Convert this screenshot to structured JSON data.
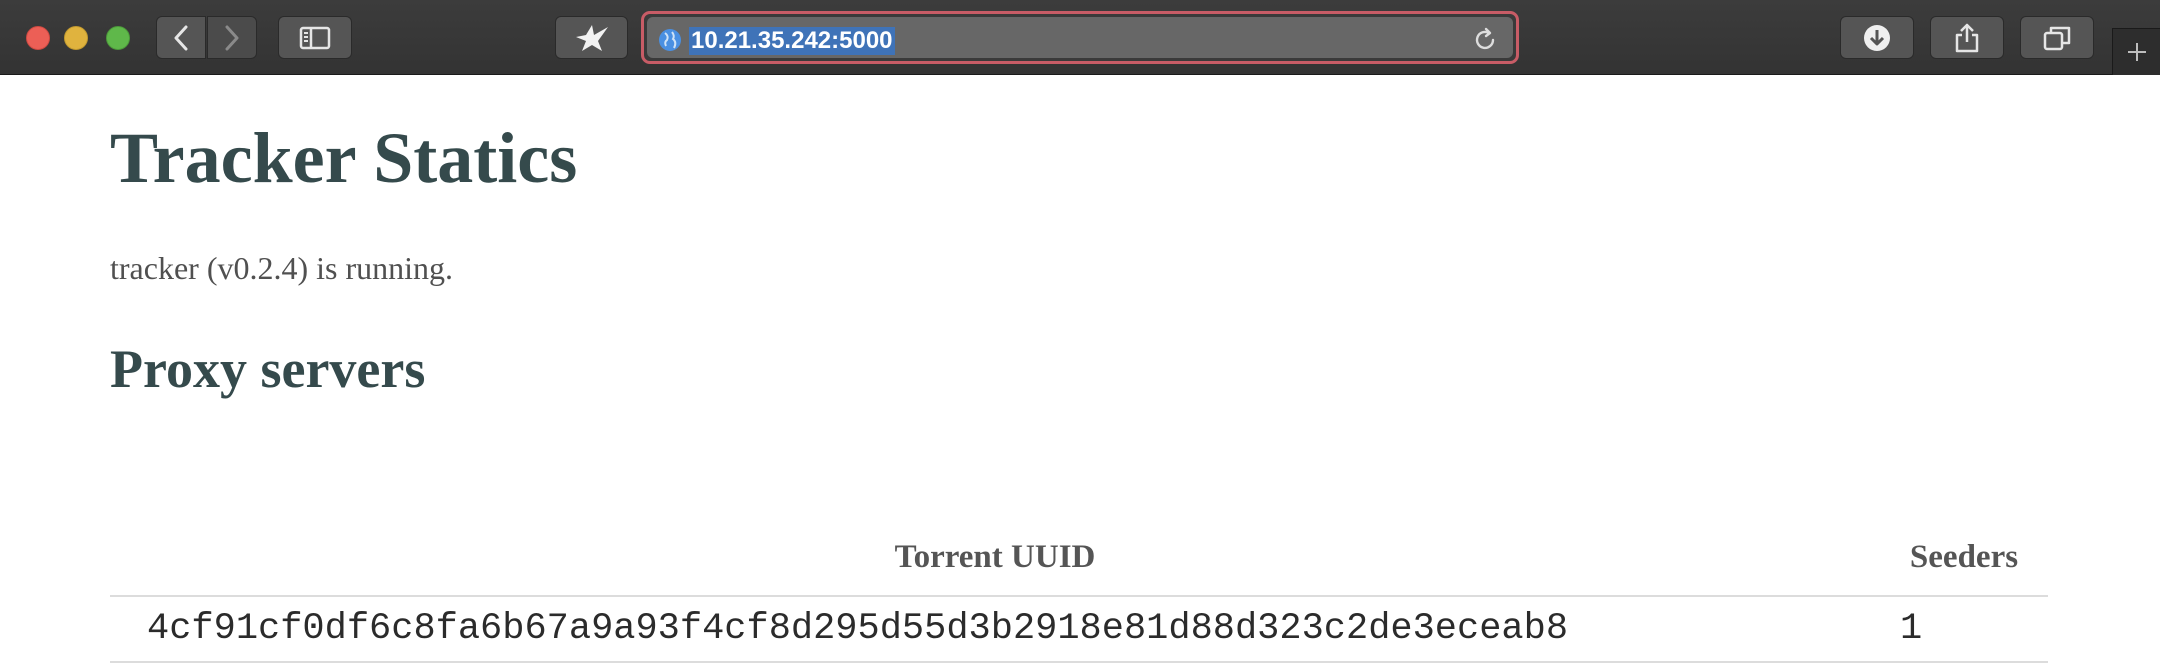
{
  "browser": {
    "url": "10.21.35.242:5000",
    "icons": {
      "back": "chevron-left-icon",
      "forward": "chevron-right-icon",
      "sidebar": "sidebar-icon",
      "bird": "bird-icon",
      "globe": "globe-icon",
      "reload": "reload-icon",
      "download": "download-icon",
      "share": "share-icon",
      "tabs": "tabs-icon",
      "new_tab": "plus-icon"
    },
    "colors": {
      "address_focus_ring": "#c85c66",
      "url_selection": "#3f73b8"
    }
  },
  "page": {
    "title": "Tracker Statics",
    "status": "tracker (v0.2.4) is running.",
    "section_title": "Proxy servers",
    "table": {
      "headers": [
        "Torrent UUID",
        "Seeders"
      ],
      "rows": [
        {
          "uuid": "4cf91cf0df6c8fa6b67a9a93f4cf8d295d55d3b2918e81d88d323c2de3eceab8",
          "seeders": "1"
        }
      ]
    },
    "colors": {
      "heading": "#354a4c",
      "text": "#505050"
    }
  }
}
